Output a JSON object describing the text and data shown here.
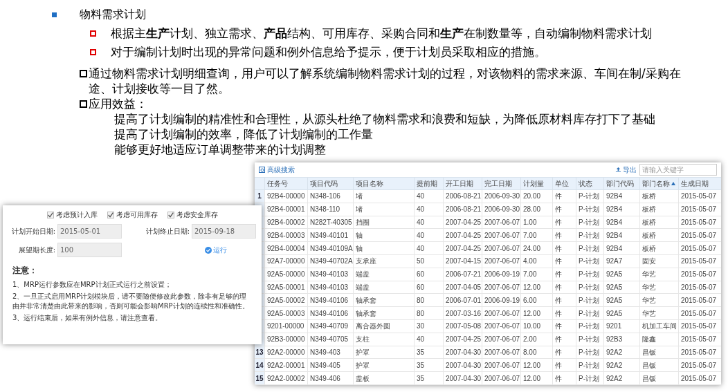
{
  "slide": {
    "title": "物料需求计划",
    "sub_bullets": [
      "根据主**生产**计划、独立需求、**产品**结构、可用库存、采购合同和**生产**在制数量等，自动编制物料需求计划",
      "对于编制计划时出现的异常问题和例外信息给予提示，便于计划员采取相应的措施。"
    ],
    "paragraphs": [
      "通过物料需求计划明细查询，用户可以了解系统编制物料需求计划的过程，对该物料的需求来源、车间在制/采购在途、计划接收等一目了然。",
      "应用效益："
    ],
    "benefits": [
      "提高了计划编制的精准性和合理性，从源头杜绝了物料需求和浪费和短缺，为降低原材料库存打下了基础",
      "提高了计划编制的效率，降低了计划编制的工作量",
      "能够更好地适应订单调整带来的计划调整"
    ]
  },
  "table_window": {
    "advanced_search": "高级搜索",
    "export": "导出",
    "search": {
      "placeholder": "请输入关键字"
    },
    "columns": [
      {
        "label": "任务号",
        "sorted": false
      },
      {
        "label": "项目代码",
        "sorted": false
      },
      {
        "label": "项目名称",
        "sorted": false
      },
      {
        "label": "提前期",
        "sorted": false
      },
      {
        "label": "开工日期",
        "sorted": false
      },
      {
        "label": "完工日期",
        "sorted": false
      },
      {
        "label": "计划量",
        "sorted": false
      },
      {
        "label": "单位",
        "sorted": false
      },
      {
        "label": "状态",
        "sorted": false
      },
      {
        "label": "部门代码",
        "sorted": false
      },
      {
        "label": "部门名称",
        "sorted": true
      },
      {
        "label": "生成日期",
        "sorted": false
      }
    ],
    "rows": [
      {
        "number": "1",
        "cells": [
          "92B4-00000",
          "N348-106",
          "堵",
          "40",
          "2006-08-21",
          "2006-09-30",
          "20.00",
          "件",
          "P-计划",
          "92B4",
          "板桥",
          "2015-05-07"
        ]
      },
      {
        "cells": [
          "92B4-00001",
          "N348-110",
          "堵",
          "40",
          "2006-08-21",
          "2006-09-30",
          "28.00",
          "件",
          "P-计划",
          "92B4",
          "板桥",
          "2015-05-07"
        ]
      },
      {
        "cells": [
          "92B4-00002",
          "N282T-40305",
          "挡圈",
          "40",
          "2007-04-25",
          "2007-06-07",
          "1.00",
          "件",
          "P-计划",
          "92B4",
          "板桥",
          "2015-05-07"
        ]
      },
      {
        "cells": [
          "92B4-00003",
          "N349-40101",
          "轴",
          "40",
          "2007-04-25",
          "2007-06-07",
          "7.00",
          "件",
          "P-计划",
          "92B4",
          "板桥",
          "2015-05-07"
        ]
      },
      {
        "cells": [
          "92B4-00004",
          "N349-40109A",
          "轴",
          "40",
          "2007-04-25",
          "2007-06-07",
          "24.00",
          "件",
          "P-计划",
          "92B4",
          "板桥",
          "2015-05-07"
        ]
      },
      {
        "cells": [
          "92A7-00000",
          "N349-40702A",
          "支承座",
          "50",
          "2007-04-15",
          "2007-06-07",
          "4.00",
          "件",
          "P-计划",
          "92A7",
          "固安",
          "2015-05-07"
        ]
      },
      {
        "cells": [
          "92A5-00000",
          "N349-40103",
          "端盖",
          "60",
          "2006-07-21",
          "2006-09-19",
          "7.00",
          "件",
          "P-计划",
          "92A5",
          "华艺",
          "2015-05-07"
        ]
      },
      {
        "cells": [
          "92A5-00001",
          "N349-40103",
          "端盖",
          "60",
          "2007-04-05",
          "2007-06-07",
          "12.00",
          "件",
          "P-计划",
          "92A5",
          "华艺",
          "2015-05-07"
        ]
      },
      {
        "cells": [
          "92A5-00002",
          "N349-40106",
          "轴承套",
          "80",
          "2006-07-01",
          "2006-09-19",
          "6.00",
          "件",
          "P-计划",
          "92A5",
          "华艺",
          "2015-05-07"
        ]
      },
      {
        "cells": [
          "92A5-00003",
          "N349-40106",
          "轴承套",
          "80",
          "2007-03-16",
          "2007-06-07",
          "12.00",
          "件",
          "P-计划",
          "92A5",
          "华艺",
          "2015-05-07"
        ]
      },
      {
        "cells": [
          "9201-00000",
          "N349-40709",
          "离合器外圆",
          "30",
          "2007-05-08",
          "2007-06-07",
          "10.00",
          "件",
          "P-计划",
          "9201",
          "机加工车间",
          "2015-05-07"
        ]
      },
      {
        "cells": [
          "92B3-00000",
          "N349-40705",
          "支柱",
          "40",
          "2007-04-25",
          "2007-06-07",
          "2.00",
          "件",
          "P-计划",
          "92B3",
          "隆鑫",
          "2015-05-07"
        ]
      },
      {
        "number": "13",
        "cells": [
          "92A2-00000",
          "N349-403",
          "护罩",
          "35",
          "2007-04-30",
          "2007-06-07",
          "8.00",
          "件",
          "P-计划",
          "92A2",
          "昌钣",
          "2015-05-07"
        ]
      },
      {
        "number": "14",
        "cells": [
          "92A2-00001",
          "N349-405",
          "护罩",
          "35",
          "2007-04-30",
          "2007-06-07",
          "12.00",
          "件",
          "P-计划",
          "92A2",
          "昌钣",
          "2015-05-07"
        ]
      },
      {
        "number": "15",
        "cells": [
          "92A2-00002",
          "N349-406",
          "盖板",
          "35",
          "2007-04-30",
          "2007-06-07",
          "12.00",
          "件",
          "P-计划",
          "92A2",
          "昌钣",
          "2015-05-07"
        ]
      }
    ]
  },
  "settings_window": {
    "options": [
      {
        "label": "考虑预计入库",
        "checked": true
      },
      {
        "label": "考虑可用库存",
        "checked": true
      },
      {
        "label": "考虑安全库存",
        "checked": true
      }
    ],
    "start_date": {
      "label": "计划开始日期:",
      "value": "2015-05-01"
    },
    "end_date": {
      "label": "计划终止日期:",
      "value": "2015-09-18"
    },
    "horizon": {
      "label": "展望期长度:",
      "value": "100"
    },
    "run": "运行",
    "notice_title": "注意：",
    "notices": [
      "1、MRP运行参数应在MRP计划正式运行之前设置；",
      "2、一旦正式启用MRP计划模块后，请不要随便修改此参数，除非有足够的理由并非常清楚由此带来的影响，否则可能会影响MRP计划的连续性和准确性。",
      "3、运行结束后，如果有例外信息，请注意查看。"
    ]
  }
}
